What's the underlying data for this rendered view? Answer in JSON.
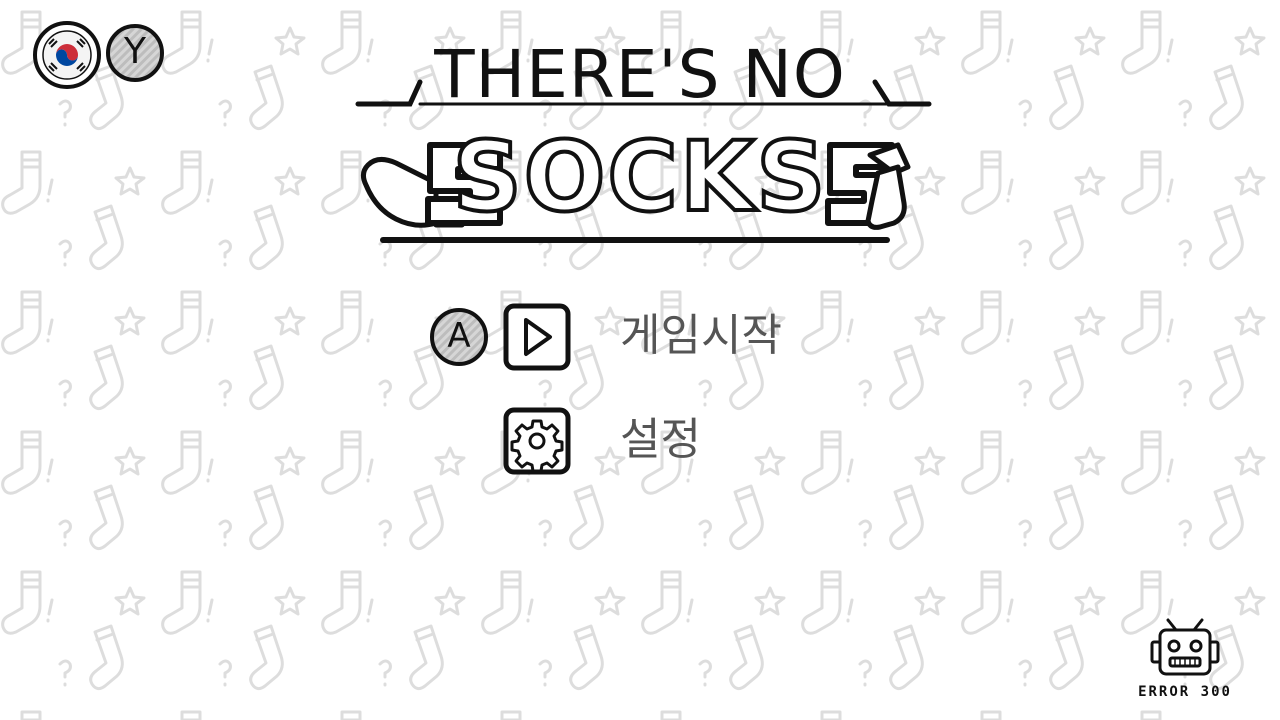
{
  "title": {
    "line1": "THERE'S NO",
    "line2": "SOCKS"
  },
  "top_controls": {
    "language_icon": "korea-flag-icon",
    "language_button_hint": "Y"
  },
  "menu": {
    "items": [
      {
        "label": "게임시작",
        "button_hint": "A",
        "icon": "play-icon"
      },
      {
        "label": "설정",
        "button_hint": "",
        "icon": "gear-icon"
      }
    ]
  },
  "developer": {
    "name": "ERROR 300",
    "icon": "robot-icon"
  },
  "colors": {
    "background": "#ffffff",
    "pattern": "#dcdcdc",
    "ink": "#111111",
    "label_gray": "#555555",
    "flag_red": "#cd2e3a",
    "flag_blue": "#0047a0"
  }
}
